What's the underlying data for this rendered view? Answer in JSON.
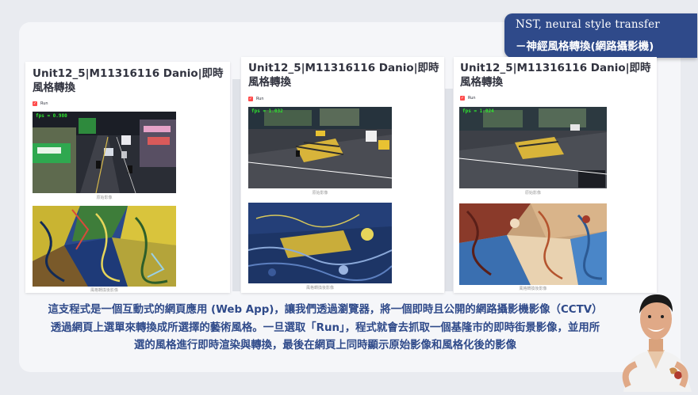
{
  "slide": {
    "title_line1": "NST, neural style transfer",
    "title_line2": "－神經風格轉換(網路攝影機)",
    "body_text": "這支程式是一個互動式的網頁應用 (Web App)，讓我們透過瀏覽器，將一個即時且公開的網路攝影機影像（CCTV）透過網頁上選單來轉換成所選擇的藝術風格。一旦選取「Run」，程式就會去抓取一個基隆市的即時街景影像，並用所選的風格進行即時渲染與轉換，最後在網頁上同時顯示原始影像和風格化後的影像"
  },
  "panels": [
    {
      "title": "Unit12_5|M11316116 Danio|即時風格轉換",
      "run_label": "Run",
      "fps": "fps = 0.980",
      "original_caption": "原始影像",
      "styled_caption": "風格轉換後影像"
    },
    {
      "title": "Unit12_5|M11316116 Danio|即時風格轉換",
      "run_label": "Run",
      "fps": "fps = 1.032",
      "original_caption": "原始影像",
      "styled_caption": "風格轉換後影像"
    },
    {
      "title": "Unit12_5|M11316116 Danio|即時風格轉換",
      "run_label": "Run",
      "fps": "fps = 1.024",
      "original_caption": "原始影像",
      "styled_caption": "風格轉換後影像"
    }
  ],
  "colors": {
    "title_box": "#2f4a8a",
    "body_text": "#2f4a8a",
    "checkbox": "#ff4b4b",
    "fps_text": "#2ee52e"
  }
}
